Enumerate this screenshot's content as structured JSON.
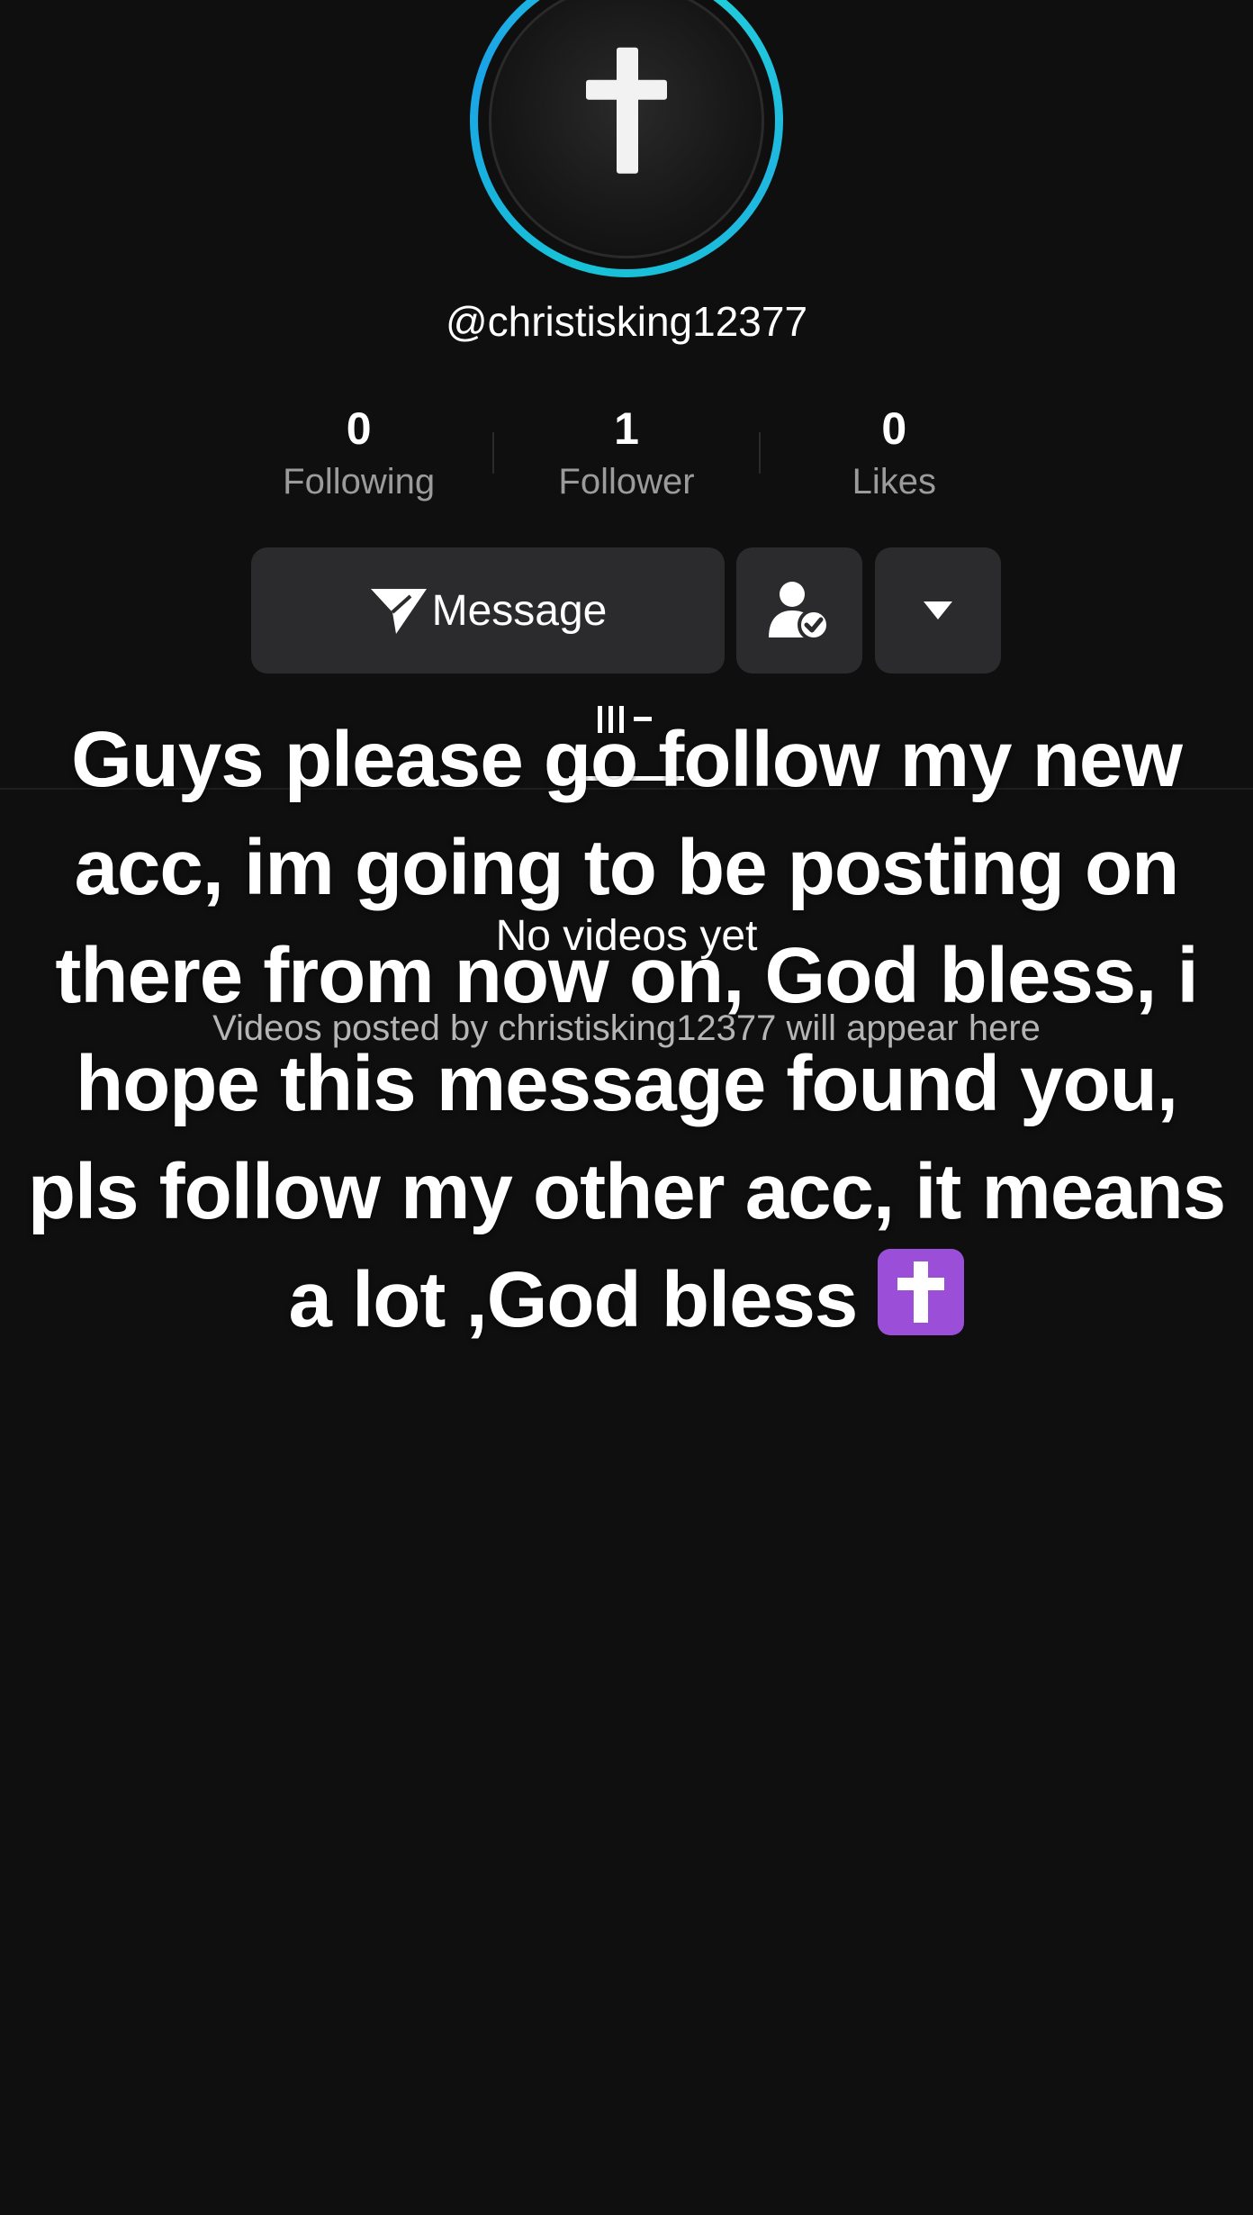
{
  "profile": {
    "username": "@christisking12377",
    "avatar_icon": "cross-icon"
  },
  "stats": [
    {
      "value": "0",
      "label": "Following"
    },
    {
      "value": "1",
      "label": "Follower"
    },
    {
      "value": "0",
      "label": "Likes"
    }
  ],
  "actions": {
    "message_label": "Message",
    "message_icon": "send-icon",
    "friend_icon": "user-check-icon",
    "dropdown_icon": "caret-down-icon"
  },
  "tabs": {
    "active_icon": "videos-grid-icon"
  },
  "empty_state": {
    "title": "No videos yet",
    "subtitle": "Videos posted by christisking12377 will appear here"
  },
  "caption": {
    "text": "Guys please go follow my new acc, im going to be posting on there from now on, God bless, i hope this message found you, pls follow my other acc, it means a lot ,God bless",
    "emoji": "latin-cross-emoji"
  },
  "colors": {
    "background": "#0f0f10",
    "button_bg": "#2b2b2d",
    "ring_accent": "#17c3d6",
    "emoji_purple": "#9b4fd8",
    "muted_text": "#9b9b9b"
  }
}
